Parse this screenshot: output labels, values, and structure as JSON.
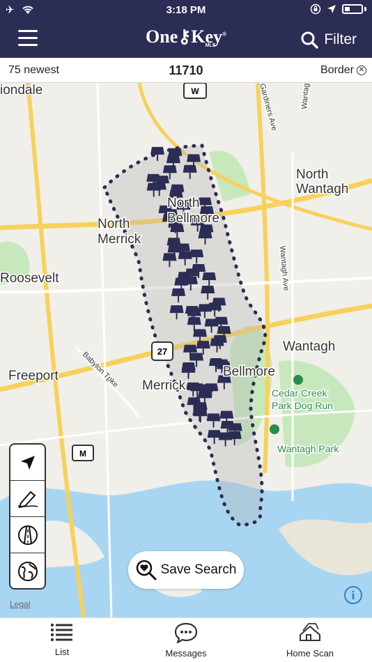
{
  "status": {
    "time": "3:18 PM"
  },
  "nav": {
    "logo_main": "One",
    "logo_key": "Key",
    "logo_reg": "®",
    "logo_sub": "MLS",
    "filter_label": "Filter"
  },
  "strip": {
    "count_label": "75 newest",
    "zip": "11710",
    "border_label": "Border"
  },
  "map": {
    "places": [
      {
        "text": "North",
        "big": true
      },
      {
        "text": "Wantagh",
        "big": true
      },
      {
        "text": "North",
        "big": true
      },
      {
        "text": "Bellmore",
        "big": true
      },
      {
        "text": "North",
        "big": true
      },
      {
        "text": "Merrick",
        "big": true
      },
      {
        "text": "Roosevelt",
        "big": true
      },
      {
        "text": "Wantagh",
        "big": true
      },
      {
        "text": "Freeport",
        "big": true
      },
      {
        "text": "Merrick",
        "big": true
      },
      {
        "text": "Bellmore",
        "big": true
      },
      {
        "text": "iondale",
        "big": true
      },
      {
        "text": "Cedar Creek",
        "big": false
      },
      {
        "text": "Park Dog Run",
        "big": false
      },
      {
        "text": "Wantagh Park",
        "big": false
      }
    ],
    "streets": [
      "Gardiners Ave",
      "Wantagh Ave",
      "Wantagh Ave",
      "Babylon Tpke"
    ],
    "shields": [
      "W",
      "27",
      "M"
    ],
    "pin_count": 75,
    "accent": "#2b2d55",
    "water": "#a8d6f2",
    "park": "#c7e8bd",
    "highway": "#f7d15a"
  },
  "tools": [
    "location-arrow-icon",
    "draw-pencil-icon",
    "road-icon",
    "globe-icon"
  ],
  "save_search_label": "Save Search",
  "legal_label": "Legal",
  "info_label": "i",
  "tabs": [
    {
      "label": "List",
      "icon": "list-icon"
    },
    {
      "label": "Messages",
      "icon": "messages-icon"
    },
    {
      "label": "Home Scan",
      "icon": "home-scan-icon"
    }
  ]
}
